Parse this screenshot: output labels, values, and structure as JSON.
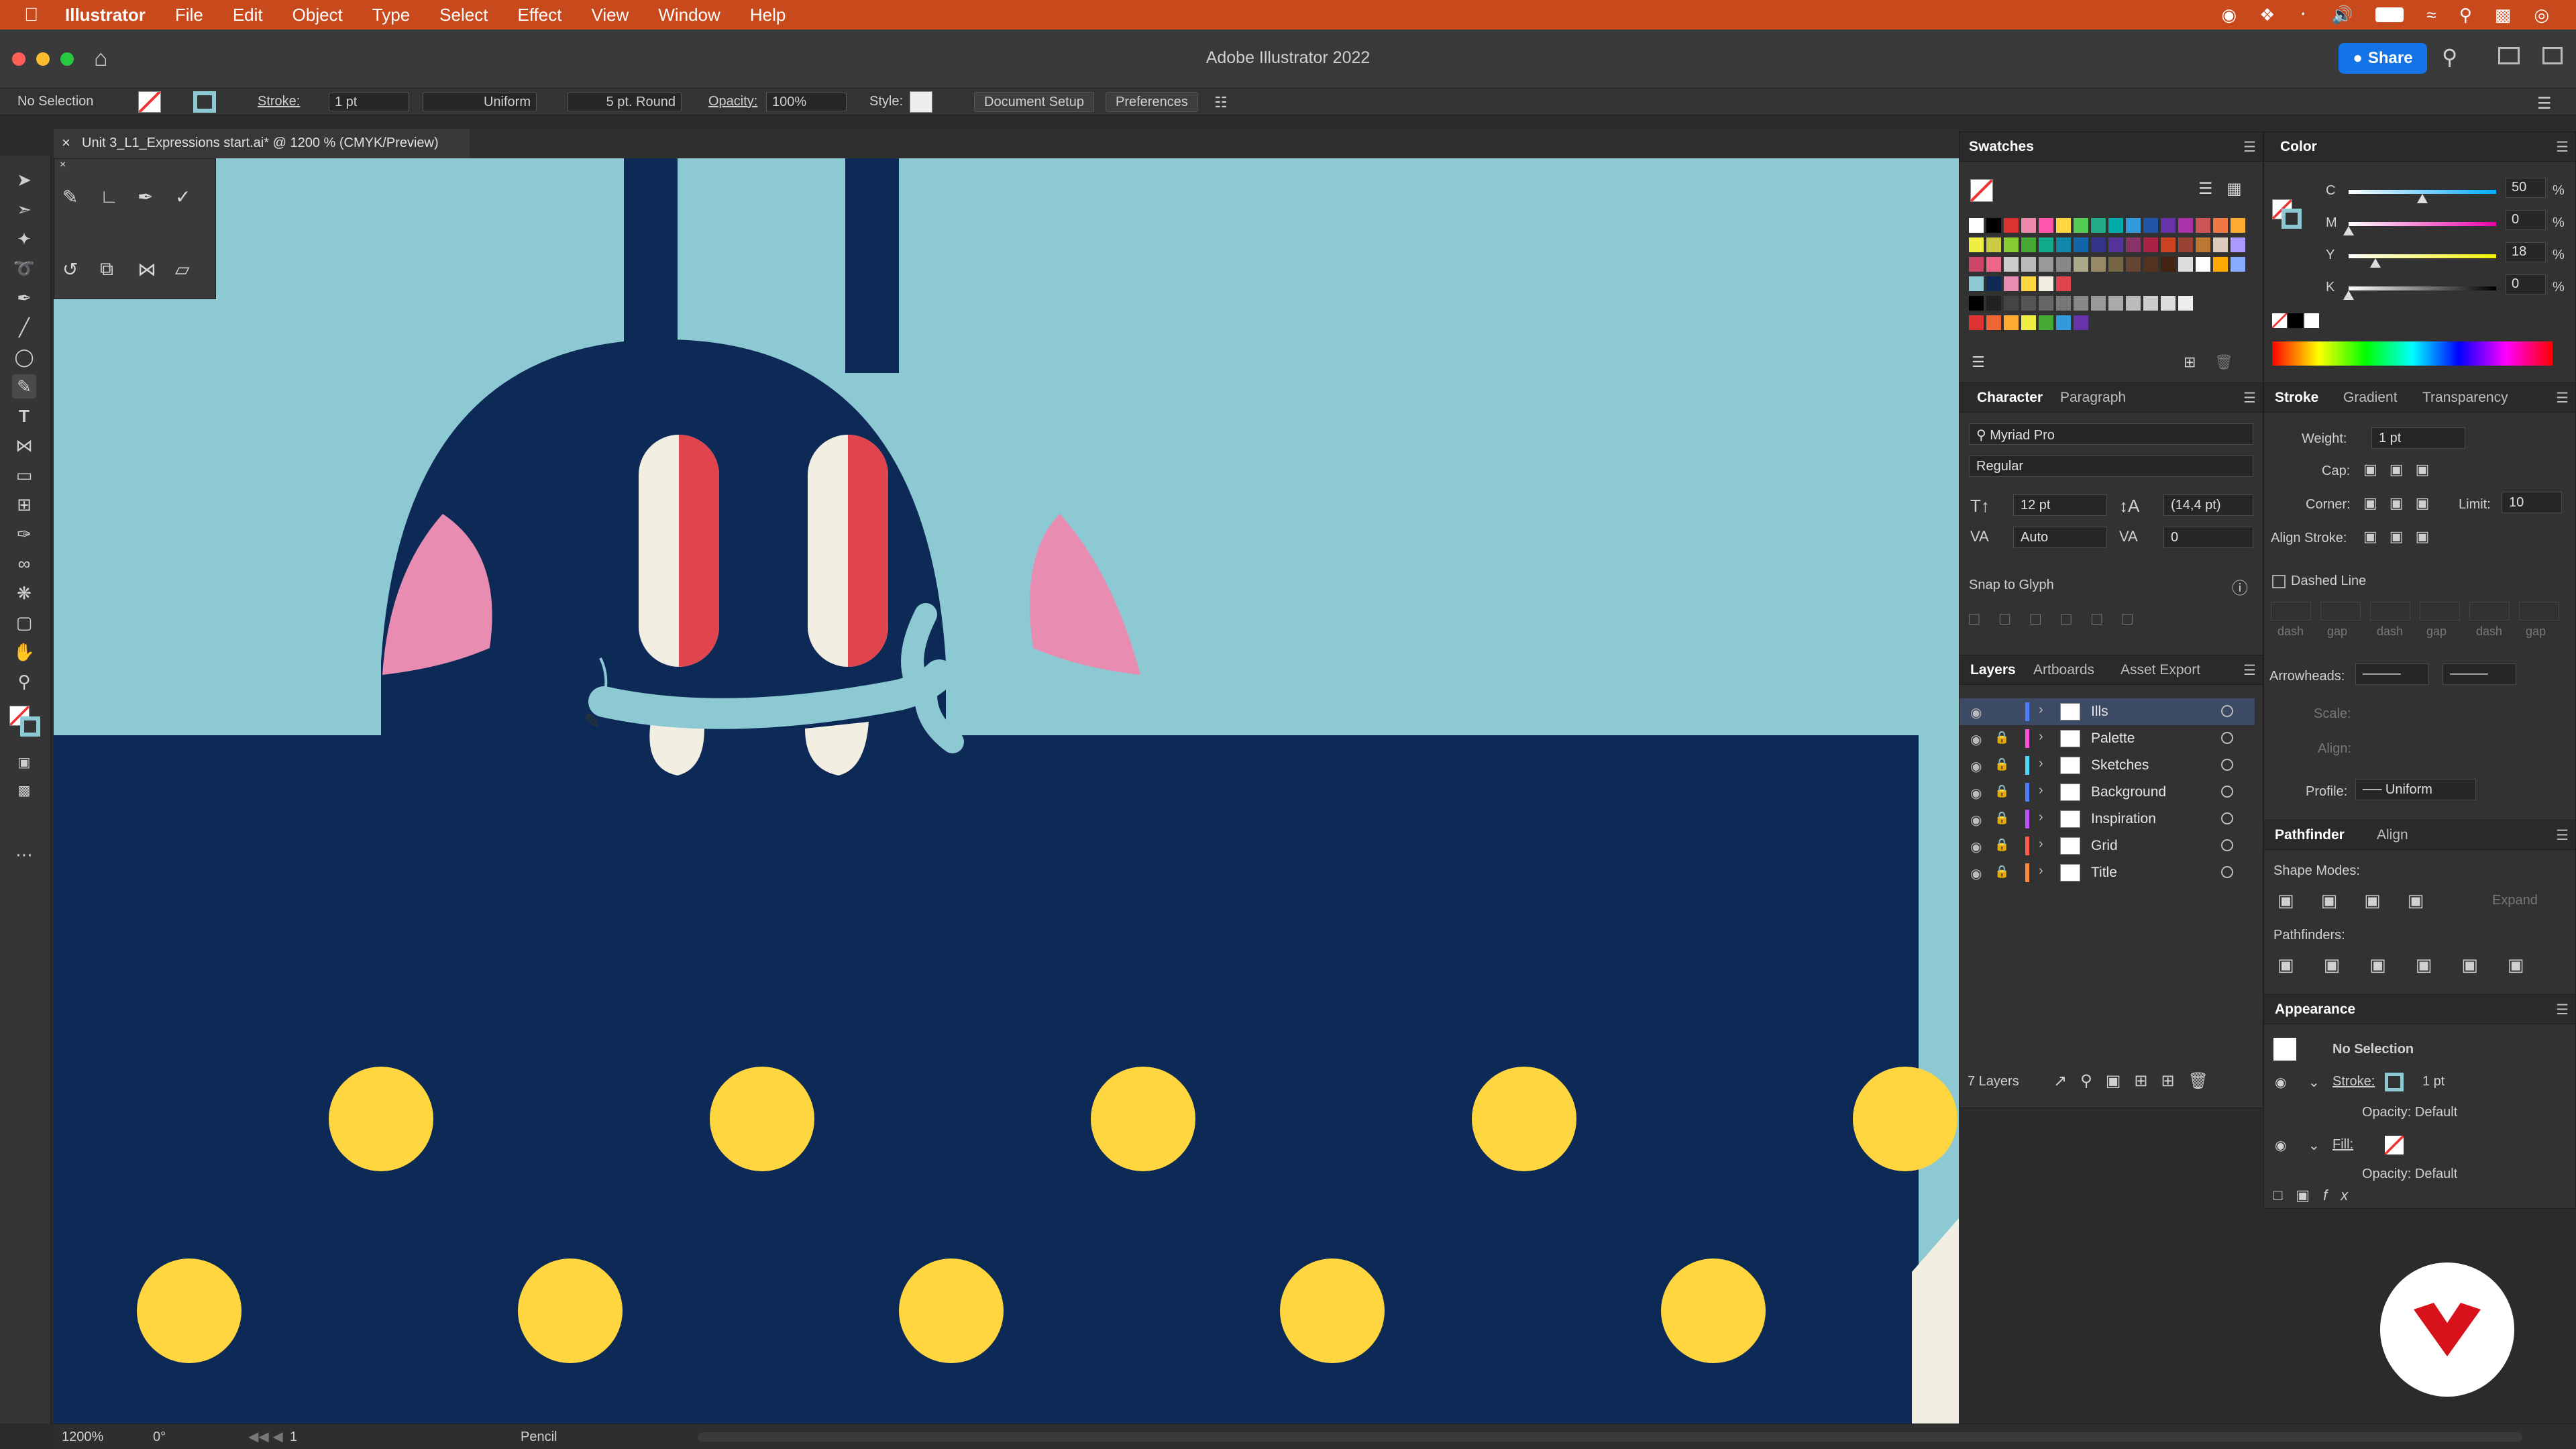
{
  "menubar": {
    "app": "Illustrator",
    "items": [
      "File",
      "Edit",
      "Object",
      "Type",
      "Select",
      "Effect",
      "View",
      "Window",
      "Help"
    ]
  },
  "window": {
    "title": "Adobe Illustrator 2022",
    "share_label": "Share"
  },
  "control": {
    "selection": "No Selection",
    "stroke_label": "Stroke:",
    "stroke_value": "1 pt",
    "profile": "Uniform",
    "brush": "5 pt. Round",
    "opacity_label": "Opacity:",
    "opacity_value": "100%",
    "style_label": "Style:",
    "doc_setup": "Document Setup",
    "preferences": "Preferences"
  },
  "document": {
    "tab": "Unit 3_L1_Expressions start.ai* @ 1200 % (CMYK/Preview)"
  },
  "tools": [
    "selection-icon",
    "direct-selection-icon",
    "magic-wand-icon",
    "lasso-icon",
    "pen-icon",
    "line-icon",
    "ellipse-icon",
    "pencil-icon",
    "type-icon",
    "width-icon",
    "eraser-icon",
    "shape-builder-icon",
    "eyedropper-icon",
    "blend-icon",
    "symbol-icon",
    "artboard-icon",
    "hand-icon",
    "zoom-icon"
  ],
  "swatches": {
    "title": "Swatches"
  },
  "character": {
    "tabs": [
      "Character",
      "Paragraph"
    ],
    "font": "Myriad Pro",
    "style": "Regular",
    "size": "12 pt",
    "leading": "(14,4 pt)",
    "kerning": "Auto",
    "tracking": "0",
    "snap": "Snap to Glyph"
  },
  "layers": {
    "tabs": [
      "Layers",
      "Artboards",
      "Asset Export"
    ],
    "items": [
      {
        "name": "Ills",
        "color": "#4a7dff"
      },
      {
        "name": "Palette",
        "color": "#ff4fd8"
      },
      {
        "name": "Sketches",
        "color": "#4fd8ff"
      },
      {
        "name": "Background",
        "color": "#4a7dff"
      },
      {
        "name": "Inspiration",
        "color": "#c04fff"
      },
      {
        "name": "Grid",
        "color": "#ff5a4a"
      },
      {
        "name": "Title",
        "color": "#ff8a3a"
      }
    ],
    "count": "7 Layers"
  },
  "color": {
    "title": "Color",
    "channels": [
      {
        "label": "C",
        "value": "50",
        "pct": "%",
        "level": 0.5
      },
      {
        "label": "M",
        "value": "0",
        "pct": "%",
        "level": 0
      },
      {
        "label": "Y",
        "value": "18",
        "pct": "%",
        "level": 0.18
      },
      {
        "label": "K",
        "value": "0",
        "pct": "%",
        "level": 0
      }
    ]
  },
  "stroke": {
    "tabs": [
      "Stroke",
      "Gradient",
      "Transparency"
    ],
    "weight_label": "Weight:",
    "weight": "1 pt",
    "cap_label": "Cap:",
    "corner_label": "Corner:",
    "limit_label": "Limit:",
    "limit": "10",
    "align_label": "Align Stroke:",
    "dashed": "Dashed Line",
    "dash_labels": [
      "dash",
      "gap",
      "dash",
      "gap",
      "dash",
      "gap"
    ],
    "arrowheads_label": "Arrowheads:",
    "scale_label": "Scale:",
    "align2_label": "Align:",
    "profile_label": "Profile:",
    "profile": "Uniform"
  },
  "pathfinder": {
    "tabs": [
      "Pathfinder",
      "Align"
    ],
    "shape_modes": "Shape Modes:",
    "pathfinders": "Pathfinders:",
    "expand": "Expand"
  },
  "appearance": {
    "title": "Appearance",
    "selection": "No Selection",
    "stroke_label": "Stroke:",
    "stroke_value": "1 pt",
    "opacity1": "Opacity: Default",
    "fill_label": "Fill:",
    "opacity2": "Opacity: Default"
  },
  "status": {
    "zoom": "1200%",
    "angle": "0°",
    "artboard": "1",
    "tool": "Pencil"
  }
}
